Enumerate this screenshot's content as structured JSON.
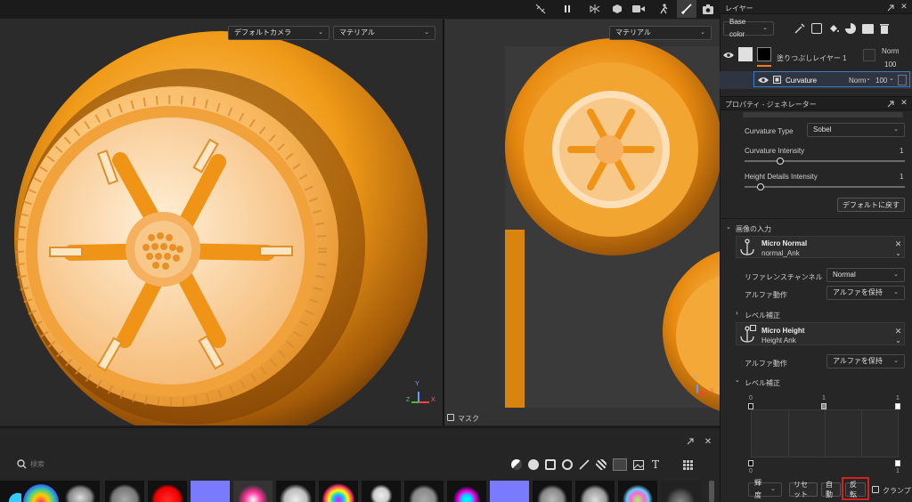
{
  "toolbar": {
    "icons": [
      "link-off-icon",
      "pause-icon",
      "symmetry-icon",
      "cube-icon",
      "video-camera-icon",
      "puppet-icon",
      "brush-icon",
      "camera-icon"
    ]
  },
  "viewport_left": {
    "camera_select": "デフォルトカメラ",
    "material_select": "マテリアル",
    "axis_labels": [
      "Y",
      "Z",
      "X"
    ]
  },
  "viewport_right": {
    "material_select": "マテリアル",
    "mask_label": "マスク",
    "axis_labels": [
      "Y",
      "X"
    ]
  },
  "layers_panel": {
    "title": "レイヤー",
    "channel_select": "Base color",
    "layer1": {
      "name": "塗りつぶしレイヤー 1",
      "blend": "Norm",
      "opacity": "100"
    },
    "layer2": {
      "name": "Curvature",
      "blend": "Norm",
      "opacity": "100"
    }
  },
  "properties_panel": {
    "title": "プロパティ - ジェネレーター",
    "curvature_type_label": "Curvature Type",
    "curvature_type_value": "Sobel",
    "curvature_intensity_label": "Curvature Intensity",
    "curvature_intensity_value": "1",
    "curvature_intensity_level": 0.22,
    "height_details_label": "Height Details Intensity",
    "height_details_value": "1",
    "height_details_level": 0.1,
    "reset_button": "デフォルトに戻す",
    "image_input_section": "画像の入力",
    "micro_normal": {
      "title": "Micro Normal",
      "subtitle": "normal_Ank"
    },
    "reference_channel_label": "リファレンスチャンネル",
    "reference_channel_value": "Normal",
    "alpha_label_1": "アルファ動作",
    "alpha_value_1": "アルファを保持",
    "level_section_1": "レベル補正",
    "micro_height": {
      "title": "Micro Height",
      "subtitle": "Height Ank"
    },
    "alpha_label_2": "アルファ動作",
    "alpha_value_2": "アルファを保持",
    "level_section_2": "レベル補正",
    "levels_top_labels": [
      "0",
      "1",
      "1"
    ],
    "levels_bottom_labels": [
      "0",
      "1"
    ],
    "mode_select": "輝度",
    "btn_reset": "リセット",
    "btn_auto": "自動",
    "btn_invert": "反転",
    "clamp_label": "クランプ"
  },
  "shelf": {
    "search_placeholder": "検索"
  },
  "colors": {
    "accent": "#f07d1e",
    "highlight_box": "#d82020",
    "orange_material": "#f0a020"
  }
}
